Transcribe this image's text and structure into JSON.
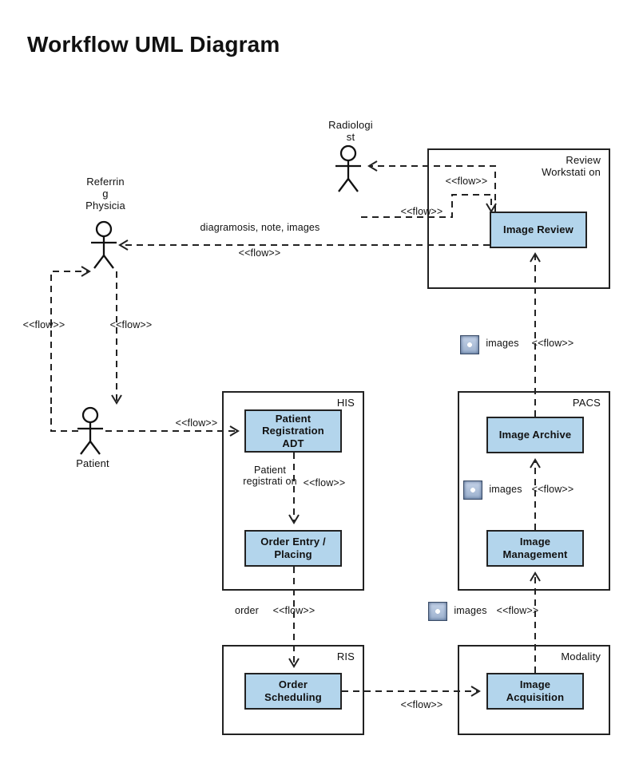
{
  "title": "Workflow UML Diagram",
  "actors": {
    "radiologist": "Radiologi\nst",
    "referring_physician": "Referrin\ng\nPhysicia",
    "patient": "Patient"
  },
  "frames": {
    "review_workstation": "Review Workstati on",
    "his": "HIS",
    "pacs": "PACS",
    "ris": "RIS",
    "modality": "Modality"
  },
  "nodes": {
    "image_review": "Image Review",
    "patient_registration_adt": "Patient Registration ADT",
    "order_entry_placing": "Order Entry / Placing",
    "image_archive": "Image Archive",
    "image_management": "Image Management",
    "order_scheduling": "Order Scheduling",
    "image_acquisition": "Image Acquisition"
  },
  "edges": {
    "flow_tag": "<<flow>>",
    "diagnosis_note_images": "diagramosis, note, images",
    "patient_registration": "Patient registrati on",
    "order": "order",
    "images": "images"
  }
}
